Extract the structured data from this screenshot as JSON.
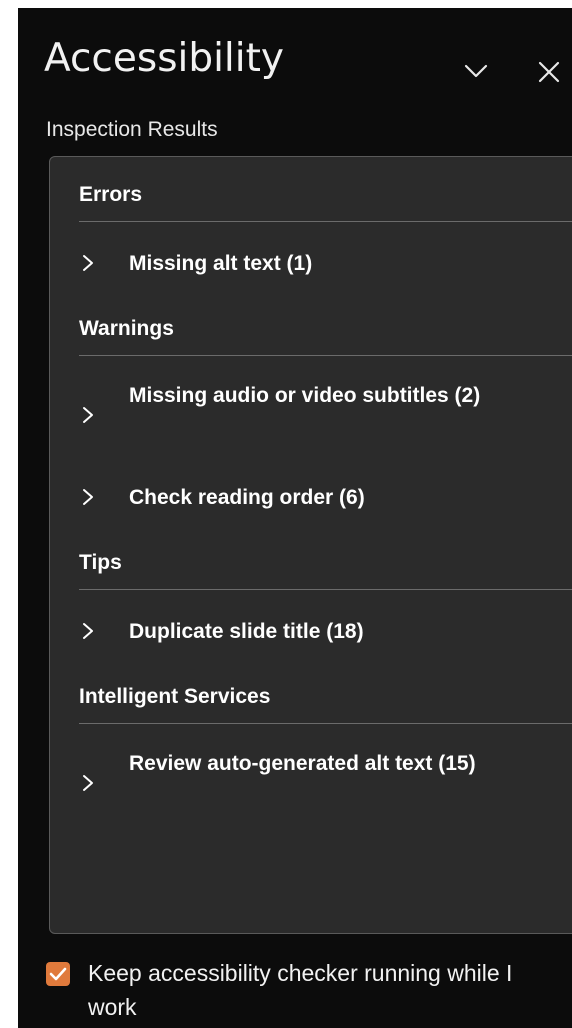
{
  "pane": {
    "title": "Accessibility",
    "collapse_icon": "chevron-down-icon",
    "close_icon": "close-icon"
  },
  "inspection": {
    "label": "Inspection Results",
    "groups": [
      {
        "heading": "Errors",
        "items": [
          {
            "label": "Missing alt text (1)"
          }
        ]
      },
      {
        "heading": "Warnings",
        "items": [
          {
            "label": "Missing audio or video subtitles (2)"
          },
          {
            "label": "Check reading order (6)"
          }
        ]
      },
      {
        "heading": "Tips",
        "items": [
          {
            "label": "Duplicate slide title (18)"
          }
        ]
      },
      {
        "heading": "Intelligent Services",
        "items": [
          {
            "label": "Review auto-generated alt text (15)"
          }
        ]
      }
    ]
  },
  "keep_running": {
    "checked": true,
    "label": "Keep accessibility checker running while I work"
  },
  "colors": {
    "pane_bg": "#0c0c0c",
    "results_bg": "#2b2b2b",
    "accent": "#e07a3c",
    "text": "#ffffff"
  }
}
